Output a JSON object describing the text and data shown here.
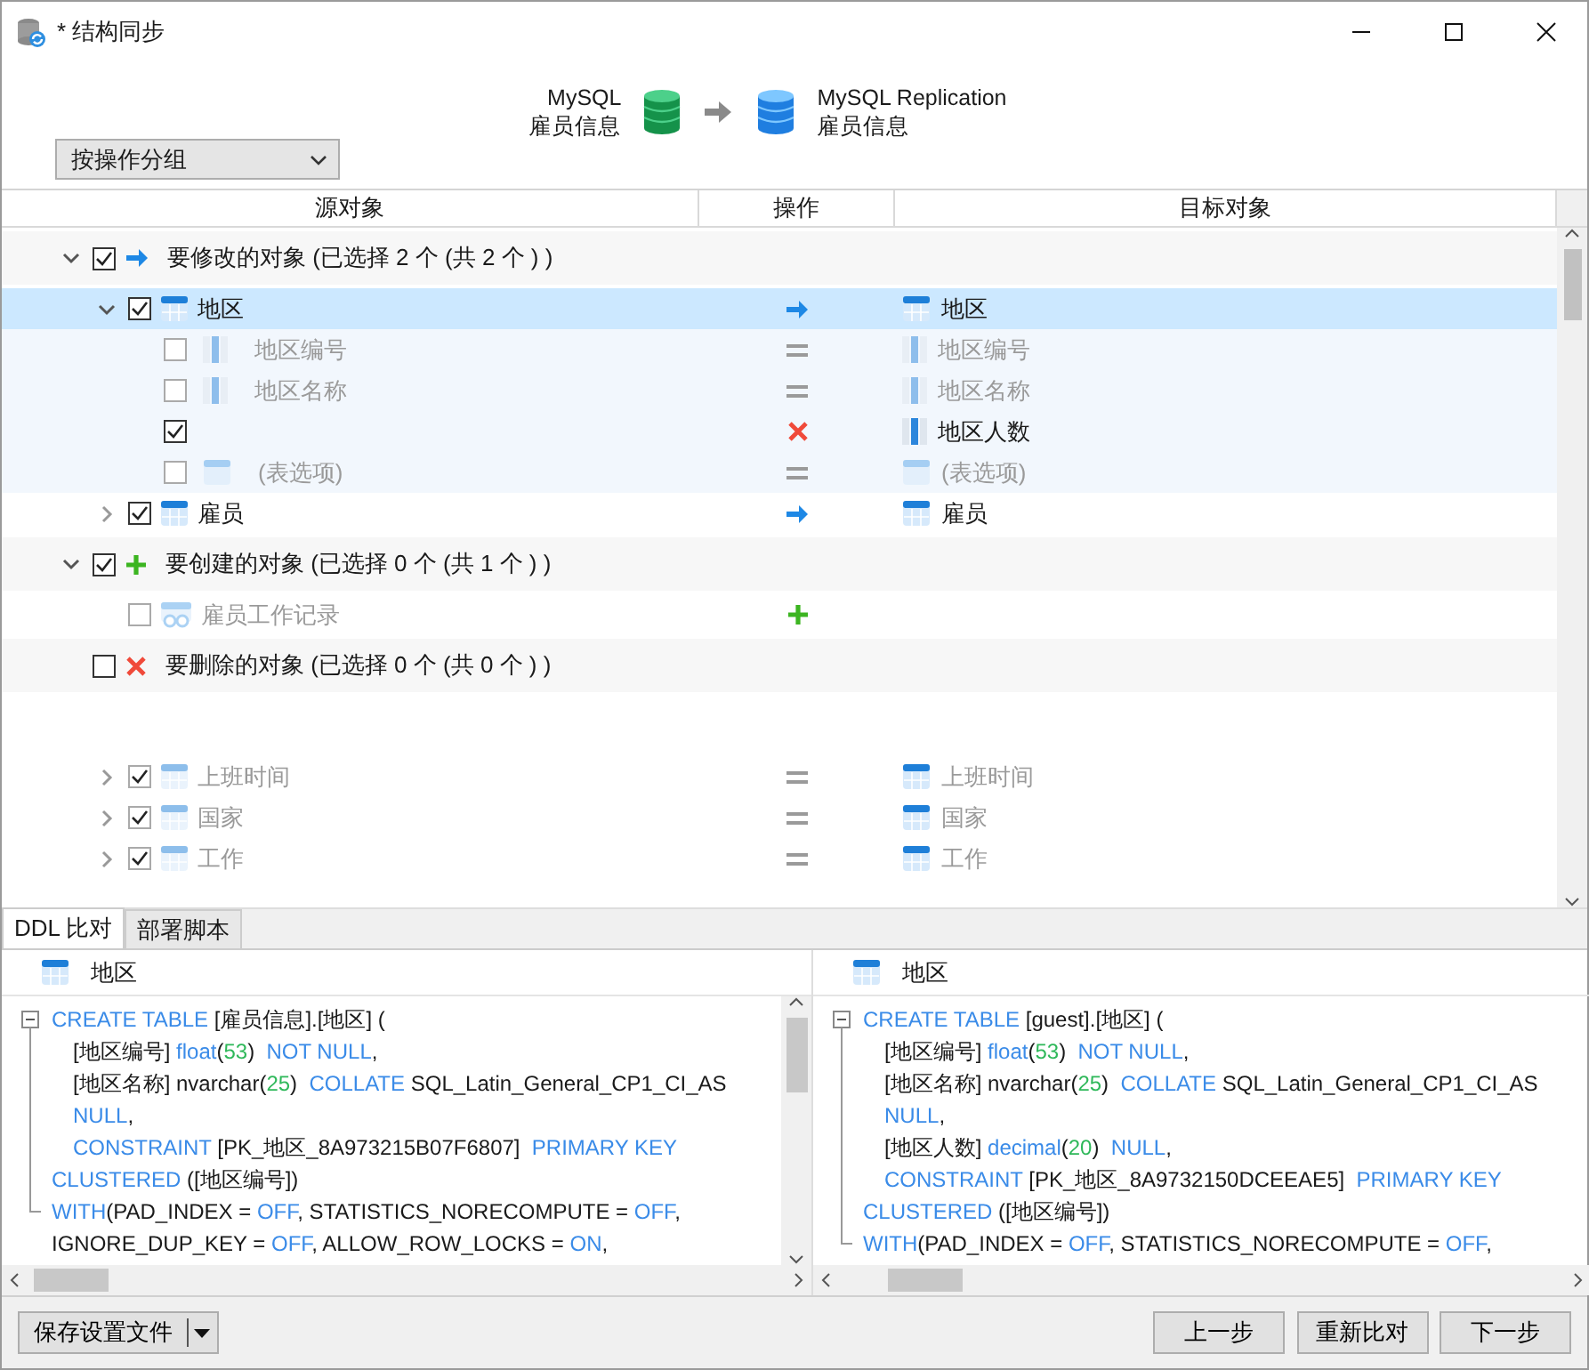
{
  "window": {
    "title": "* 结构同步"
  },
  "connection": {
    "source": {
      "type": "MySQL",
      "name": "雇员信息"
    },
    "target": {
      "type": "MySQL Replication",
      "name": "雇员信息"
    }
  },
  "group_dropdown": {
    "value": "按操作分组"
  },
  "columns": [
    "源对象",
    "操作",
    "目标对象"
  ],
  "tree": [
    {
      "kind": "group",
      "operation": {
        "kind": "modify"
      },
      "label": "要修改的对象 (已选择 2 个 (共 2 个 ) )",
      "checked": true,
      "expanded": true,
      "children": [
        {
          "kind": "table",
          "source": "地区",
          "target": "地区",
          "operation": {
            "kind": "modify"
          },
          "checked": true,
          "expanded": true,
          "selected": true,
          "dimmed": false,
          "children": [
            {
              "kind": "field",
              "source": "地区编号",
              "target": "地区编号",
              "operation": {
                "kind": "equal"
              },
              "checked": false,
              "selected": false,
              "dimmed": true
            },
            {
              "kind": "field",
              "source": "地区名称",
              "target": "地区名称",
              "operation": {
                "kind": "equal"
              },
              "checked": false,
              "selected": false,
              "dimmed": true
            },
            {
              "kind": "field",
              "target": "地区人数",
              "operation": {
                "kind": "delete"
              },
              "checked": true,
              "selected": false,
              "dimmed": false
            },
            {
              "kind": "options",
              "source": "(表选项)",
              "target": "(表选项)",
              "operation": {
                "kind": "equal"
              },
              "checked": false,
              "selected": false,
              "dimmed": true
            }
          ]
        },
        {
          "kind": "table",
          "source": "雇员",
          "target": "雇员",
          "operation": {
            "kind": "modify"
          },
          "checked": true,
          "expanded": false,
          "selected": false,
          "dimmed": false
        }
      ]
    },
    {
      "kind": "group",
      "operation": {
        "kind": "create"
      },
      "label": "要创建的对象 (已选择 0 个 (共 1 个 ) )",
      "checked": true,
      "expanded": true,
      "children": [
        {
          "kind": "view",
          "source": "雇员工作记录",
          "operation": {
            "kind": "create"
          },
          "checked": false,
          "selected": false,
          "dimmed": true
        }
      ]
    },
    {
      "kind": "group",
      "operation": {
        "kind": "delete"
      },
      "label": "要删除的对象 (已选择 0 个 (共 0 个 ) )",
      "checked": false
    }
  ],
  "unchanged_objects": [
    {
      "kind": "table",
      "source": "上班时间",
      "target": "上班时间",
      "operation": {
        "kind": "equal"
      },
      "checked": true,
      "expanded": false,
      "selected": false,
      "dimmed": true
    },
    {
      "kind": "table",
      "source": "国家",
      "target": "国家",
      "operation": {
        "kind": "equal"
      },
      "checked": true,
      "expanded": false,
      "selected": false,
      "dimmed": true
    },
    {
      "kind": "table",
      "source": "工作",
      "target": "工作",
      "operation": {
        "kind": "equal"
      },
      "checked": true,
      "expanded": false,
      "selected": false,
      "dimmed": true
    }
  ],
  "bottom_tabs": [
    {
      "label": "DDL 比对",
      "selected": true
    },
    {
      "label": "部署脚本",
      "selected": false
    }
  ],
  "ddl_panes": [
    {
      "title": "地区",
      "lines": [
        {
          "kind": "head",
          "tokens": [
            {
              "kind": "kw",
              "text": "CREATE TABLE"
            },
            {
              "kind": "plain",
              "text": " [雇员信息].[地区] ("
            }
          ]
        },
        {
          "kind": "body",
          "tokens": [
            {
              "kind": "plain",
              "text": "[地区编号] "
            },
            {
              "kind": "kw",
              "text": "float"
            },
            {
              "kind": "plain",
              "text": "("
            },
            {
              "kind": "num",
              "text": "53"
            },
            {
              "kind": "plain",
              "text": ")  "
            },
            {
              "kind": "kw",
              "text": "NOT NULL"
            },
            {
              "kind": "plain",
              "text": ","
            }
          ]
        },
        {
          "kind": "body",
          "tokens": [
            {
              "kind": "plain",
              "text": "[地区名称] nvarchar("
            },
            {
              "kind": "num",
              "text": "25"
            },
            {
              "kind": "plain",
              "text": ")  "
            },
            {
              "kind": "kw",
              "text": "COLLATE"
            },
            {
              "kind": "plain",
              "text": " SQL_Latin_General_CP1_CI_AS"
            }
          ]
        },
        {
          "kind": "body",
          "tokens": [
            {
              "kind": "kw",
              "text": "NULL"
            },
            {
              "kind": "plain",
              "text": ","
            }
          ]
        },
        {
          "kind": "body",
          "tokens": [
            {
              "kind": "kw",
              "text": "CONSTRAINT"
            },
            {
              "kind": "plain",
              "text": " [PK_地区_8A973215B07F6807]  "
            },
            {
              "kind": "kw",
              "text": "PRIMARY KEY"
            }
          ]
        },
        {
          "kind": "head",
          "tokens": [
            {
              "kind": "kw",
              "text": "CLUSTERED"
            },
            {
              "kind": "plain",
              "text": " ([地区编号])"
            }
          ]
        },
        {
          "kind": "head",
          "tokens": [
            {
              "kind": "kw",
              "text": "WITH"
            },
            {
              "kind": "plain",
              "text": "(PAD_INDEX = "
            },
            {
              "kind": "kw",
              "text": "OFF"
            },
            {
              "kind": "plain",
              "text": ", STATISTICS_NORECOMPUTE = "
            },
            {
              "kind": "kw",
              "text": "OFF"
            },
            {
              "kind": "plain",
              "text": ","
            }
          ]
        },
        {
          "kind": "head",
          "tokens": [
            {
              "kind": "plain",
              "text": "IGNORE_DUP_KEY = "
            },
            {
              "kind": "kw",
              "text": "OFF"
            },
            {
              "kind": "plain",
              "text": ", ALLOW_ROW_LOCKS = "
            },
            {
              "kind": "kw",
              "text": "ON"
            },
            {
              "kind": "plain",
              "text": ","
            }
          ]
        }
      ]
    },
    {
      "title": "地区",
      "lines": [
        {
          "kind": "head",
          "tokens": [
            {
              "kind": "kw",
              "text": "CREATE TABLE"
            },
            {
              "kind": "plain",
              "text": " [guest].[地区] ("
            }
          ]
        },
        {
          "kind": "body",
          "tokens": [
            {
              "kind": "plain",
              "text": "[地区编号] "
            },
            {
              "kind": "kw",
              "text": "float"
            },
            {
              "kind": "plain",
              "text": "("
            },
            {
              "kind": "num",
              "text": "53"
            },
            {
              "kind": "plain",
              "text": ")  "
            },
            {
              "kind": "kw",
              "text": "NOT NULL"
            },
            {
              "kind": "plain",
              "text": ","
            }
          ]
        },
        {
          "kind": "body",
          "tokens": [
            {
              "kind": "plain",
              "text": "[地区名称] nvarchar("
            },
            {
              "kind": "num",
              "text": "25"
            },
            {
              "kind": "plain",
              "text": ")  "
            },
            {
              "kind": "kw",
              "text": "COLLATE"
            },
            {
              "kind": "plain",
              "text": " SQL_Latin_General_CP1_CI_AS"
            }
          ]
        },
        {
          "kind": "body",
          "tokens": [
            {
              "kind": "kw",
              "text": "NULL"
            },
            {
              "kind": "plain",
              "text": ","
            }
          ]
        },
        {
          "kind": "body",
          "tokens": [
            {
              "kind": "plain",
              "text": "[地区人数] "
            },
            {
              "kind": "kw",
              "text": "decimal"
            },
            {
              "kind": "plain",
              "text": "("
            },
            {
              "kind": "num",
              "text": "20"
            },
            {
              "kind": "plain",
              "text": ")  "
            },
            {
              "kind": "kw",
              "text": "NULL"
            },
            {
              "kind": "plain",
              "text": ","
            }
          ]
        },
        {
          "kind": "body",
          "tokens": [
            {
              "kind": "kw",
              "text": "CONSTRAINT"
            },
            {
              "kind": "plain",
              "text": " [PK_地区_8A9732150DCEEAE5]  "
            },
            {
              "kind": "kw",
              "text": "PRIMARY KEY"
            }
          ]
        },
        {
          "kind": "head",
          "tokens": [
            {
              "kind": "kw",
              "text": "CLUSTERED"
            },
            {
              "kind": "plain",
              "text": " ([地区编号])"
            }
          ]
        },
        {
          "kind": "head",
          "tokens": [
            {
              "kind": "kw",
              "text": "WITH"
            },
            {
              "kind": "plain",
              "text": "(PAD_INDEX = "
            },
            {
              "kind": "kw",
              "text": "OFF"
            },
            {
              "kind": "plain",
              "text": ", STATISTICS_NORECOMPUTE = "
            },
            {
              "kind": "kw",
              "text": "OFF"
            },
            {
              "kind": "plain",
              "text": ","
            }
          ]
        }
      ]
    }
  ],
  "footer": {
    "save_button": "保存设置文件",
    "buttons": [
      "上一步",
      "重新比对",
      "下一步"
    ]
  }
}
